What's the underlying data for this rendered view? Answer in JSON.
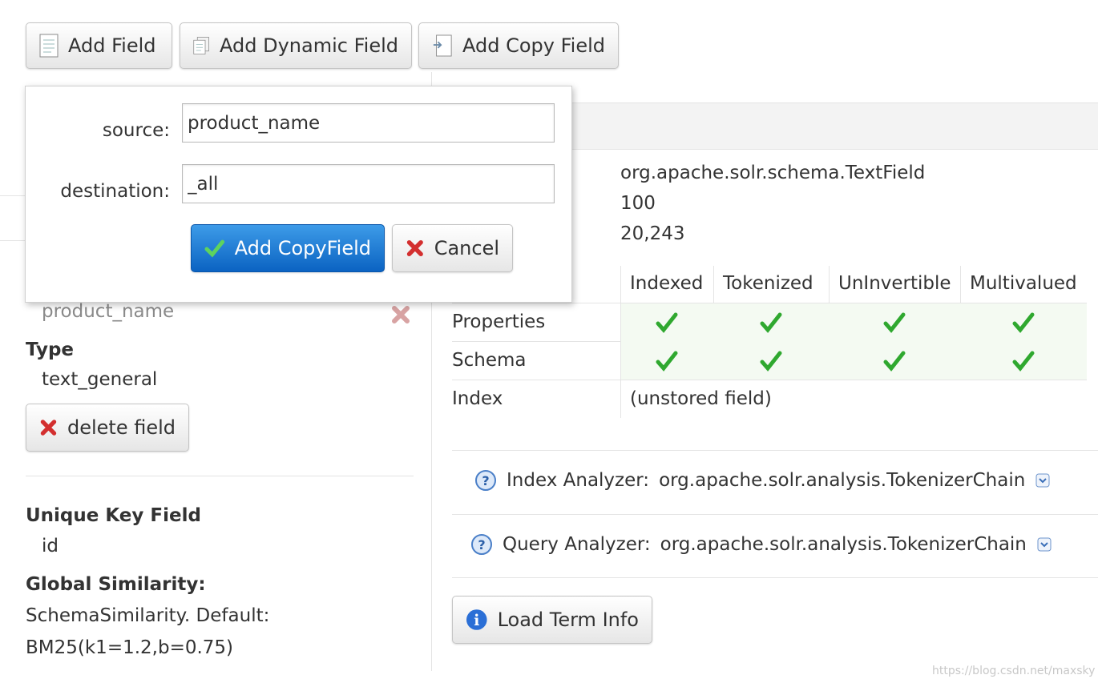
{
  "toolbar": {
    "add_field": "Add Field",
    "add_dynamic_field": "Add Dynamic Field",
    "add_copy_field": "Add Copy Field"
  },
  "popup": {
    "source_label": "source:",
    "source_value": "product_name",
    "destination_label": "destination:",
    "destination_value": "_all",
    "submit_label": "Add CopyField",
    "cancel_label": "Cancel"
  },
  "left": {
    "copy_source_item": "product_name",
    "type_heading": "Type",
    "type_value": "text_general",
    "delete_label": "delete field",
    "unique_key_heading": "Unique Key Field",
    "unique_key_value": "id",
    "global_similarity_heading": "Global Similarity:",
    "global_similarity_line1": "SchemaSimilarity. Default:",
    "global_similarity_line2": "BM25(k1=1.2,b=0.75)"
  },
  "right": {
    "class_name": "org.apache.solr.schema.TextField",
    "value_100": "100",
    "value_count": "20,243",
    "flags": {
      "headers": [
        "Indexed",
        "Tokenized",
        "UnInvertible",
        "Multivalued"
      ],
      "rows": [
        {
          "label": "Properties",
          "checks": [
            true,
            true,
            true,
            true
          ]
        },
        {
          "label": "Schema",
          "checks": [
            true,
            true,
            true,
            true
          ]
        },
        {
          "label": "Index",
          "text": "(unstored field)"
        }
      ]
    },
    "index_analyzer_label": "Index Analyzer:",
    "index_analyzer_value": "org.apache.solr.analysis.TokenizerChain",
    "query_analyzer_label": "Query Analyzer:",
    "query_analyzer_value": "org.apache.solr.analysis.TokenizerChain",
    "load_term_info": "Load Term Info"
  },
  "watermark": "https://blog.csdn.net/maxsky",
  "colors": {
    "primary": "#0b63c2",
    "check": "#2fa82f",
    "delete": "#d32f2f",
    "info": "#2b6fd6"
  }
}
